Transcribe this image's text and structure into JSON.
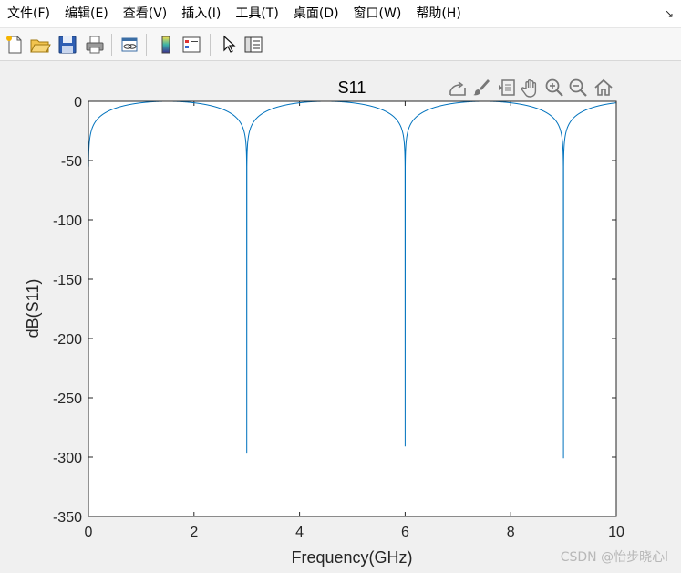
{
  "menu": {
    "items": [
      "文件(F)",
      "编辑(E)",
      "查看(V)",
      "插入(I)",
      "工具(T)",
      "桌面(D)",
      "窗口(W)",
      "帮助(H)"
    ]
  },
  "toolbar": {
    "buttons": [
      "new-figure-icon",
      "open-file-icon",
      "save-icon",
      "print-icon",
      "link-plot-icon",
      "colorbar-icon",
      "legend-icon",
      "edit-plot-pointer-icon",
      "property-inspector-icon"
    ]
  },
  "axes_toolbar": {
    "buttons": [
      "export-icon",
      "brush-icon",
      "data-tips-icon",
      "pan-icon",
      "zoom-in-icon",
      "zoom-out-icon",
      "restore-view-icon"
    ]
  },
  "line_color": "#0072bd",
  "chart_data": {
    "type": "line",
    "title": "S11",
    "xlabel": "Frequency(GHz)",
    "ylabel": "dB(S11)",
    "xlim": [
      0,
      10
    ],
    "ylim": [
      -350,
      0
    ],
    "xticks": [
      "0",
      "2",
      "4",
      "6",
      "8",
      "10"
    ],
    "yticks": [
      "0",
      "-50",
      "-100",
      "-150",
      "-200",
      "-250",
      "-300",
      "-350"
    ],
    "grid": false,
    "series": [
      {
        "notch_frequencies": [
          3,
          6,
          9
        ],
        "notch_depths": [
          -297,
          -291,
          -301
        ],
        "curve": "dB(S11) = 20*log10(|sin(pi*f/3)|)",
        "start_value_at_0": -45
      }
    ]
  },
  "watermark": "CSDN @怡步晓心l"
}
